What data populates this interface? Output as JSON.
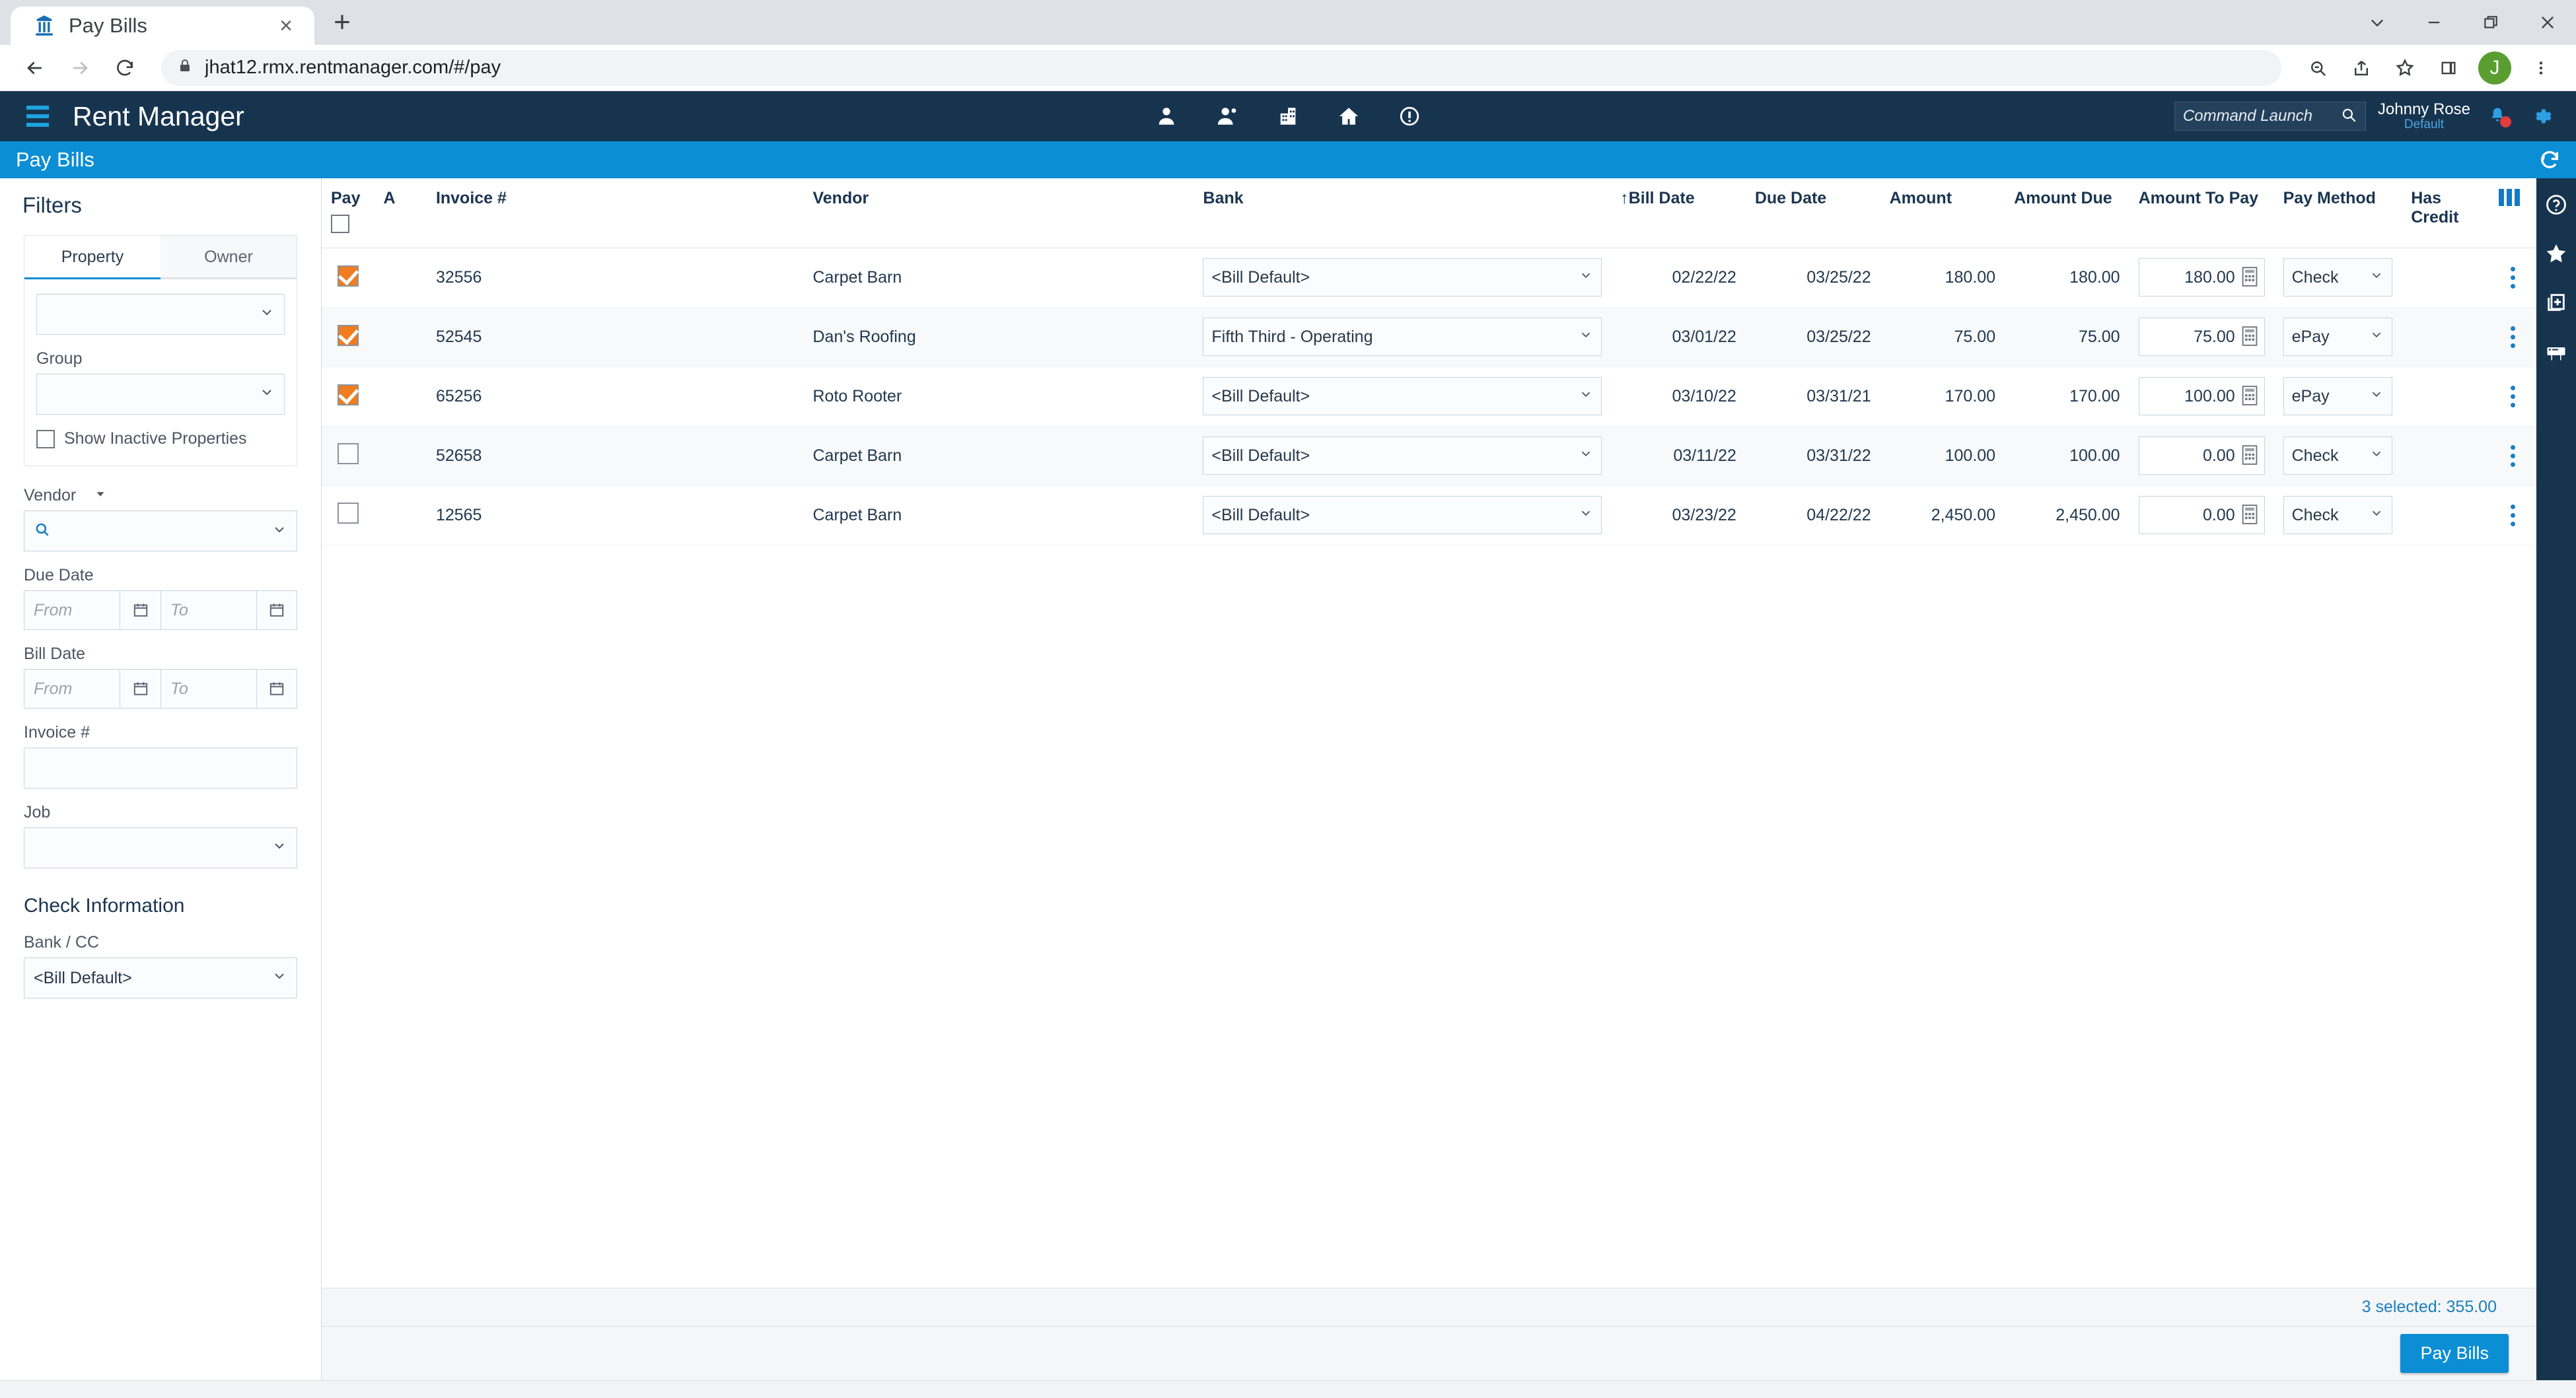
{
  "browser": {
    "tab_title": "Pay Bills",
    "favicon": "building-icon",
    "close_label": "×",
    "new_tab_label": "+",
    "url": "jhat12.rmx.rentmanager.com/#/pay",
    "profile_initial": "J",
    "window_controls": [
      "chevron-down",
      "minimize",
      "restore",
      "close"
    ],
    "omnibox_icons": [
      "zoom-out-icon",
      "share-icon",
      "star-icon",
      "side-panel-icon"
    ],
    "nav": {
      "back": "back-icon",
      "forward": "forward-icon",
      "reload": "reload-icon",
      "lock": "lock-icon"
    }
  },
  "app_header": {
    "brand": "Rent Manager",
    "center_icons": [
      "tenant-icon",
      "prospect-icon",
      "property-icon",
      "home-icon",
      "alert-icon"
    ],
    "command_launch_placeholder": "Command Launch",
    "user_name": "Johnny Rose",
    "user_role": "Default",
    "notification_icon": "bell-icon",
    "settings_icon": "gear-icon"
  },
  "breadcrumb": {
    "title": "Pay Bills",
    "refresh_icon": "refresh-icon"
  },
  "sidebar": {
    "title": "Filters",
    "tabs": [
      {
        "label": "Property",
        "active": true
      },
      {
        "label": "Owner",
        "active": false
      }
    ],
    "property_select_value": "",
    "group_label": "Group",
    "group_select_value": "",
    "show_inactive_label": "Show Inactive Properties",
    "show_inactive_checked": false,
    "vendor_label": "Vendor",
    "vendor_value": "",
    "due_date_label": "Due Date",
    "bill_date_label": "Bill Date",
    "from_placeholder": "From",
    "to_placeholder": "To",
    "invoice_label": "Invoice #",
    "invoice_value": "",
    "job_label": "Job",
    "job_value": "",
    "check_info_title": "Check Information",
    "bank_cc_label": "Bank / CC",
    "bank_cc_value": "<Bill Default>"
  },
  "grid": {
    "columns": [
      {
        "key": "pay",
        "label": "Pay"
      },
      {
        "key": "a",
        "label": "A"
      },
      {
        "key": "invoice",
        "label": "Invoice #"
      },
      {
        "key": "vendor",
        "label": "Vendor"
      },
      {
        "key": "bank",
        "label": "Bank"
      },
      {
        "key": "bill_date",
        "label": "Bill Date",
        "sort": "↑"
      },
      {
        "key": "due_date",
        "label": "Due Date"
      },
      {
        "key": "amount",
        "label": "Amount"
      },
      {
        "key": "amount_due",
        "label": "Amount Due"
      },
      {
        "key": "amount_to_pay",
        "label": "Amount To Pay"
      },
      {
        "key": "pay_method",
        "label": "Pay Method"
      },
      {
        "key": "has_credit",
        "label": "Has Credit"
      }
    ],
    "column_settings_icon": "column-grip-icon",
    "header_select_all_checked": false,
    "rows": [
      {
        "checked": true,
        "a": "",
        "invoice": "32556",
        "vendor": "Carpet Barn",
        "bank": "<Bill Default>",
        "bill_date": "02/22/22",
        "due_date": "03/25/22",
        "amount": "180.00",
        "amount_due": "180.00",
        "amount_to_pay": "180.00",
        "pay_method": "Check",
        "has_credit": ""
      },
      {
        "checked": true,
        "a": "",
        "invoice": "52545",
        "vendor": "Dan's Roofing",
        "bank": "Fifth Third - Operating",
        "bill_date": "03/01/22",
        "due_date": "03/25/22",
        "amount": "75.00",
        "amount_due": "75.00",
        "amount_to_pay": "75.00",
        "pay_method": "ePay",
        "has_credit": ""
      },
      {
        "checked": true,
        "a": "",
        "invoice": "65256",
        "vendor": "Roto Rooter",
        "bank": "<Bill Default>",
        "bill_date": "03/10/22",
        "due_date": "03/31/21",
        "amount": "170.00",
        "amount_due": "170.00",
        "amount_to_pay": "100.00",
        "pay_method": "ePay",
        "has_credit": ""
      },
      {
        "checked": false,
        "a": "",
        "invoice": "52658",
        "vendor": "Carpet Barn",
        "bank": "<Bill Default>",
        "bill_date": "03/11/22",
        "due_date": "03/31/22",
        "amount": "100.00",
        "amount_due": "100.00",
        "amount_to_pay": "0.00",
        "pay_method": "Check",
        "has_credit": ""
      },
      {
        "checked": false,
        "a": "",
        "invoice": "12565",
        "vendor": "Carpet Barn",
        "bank": "<Bill Default>",
        "bill_date": "03/23/22",
        "due_date": "04/22/22",
        "amount": "2,450.00",
        "amount_due": "2,450.00",
        "amount_to_pay": "0.00",
        "pay_method": "Check",
        "has_credit": ""
      }
    ]
  },
  "footer": {
    "status_text": "3 selected:  355.00",
    "pay_bills_button": "Pay Bills"
  },
  "right_rail": {
    "icons": [
      "help-icon",
      "favorite-star-icon",
      "add-page-icon",
      "print-icon"
    ]
  },
  "colors": {
    "header_navy": "#17344f",
    "accent_blue": "#0b8ed4",
    "checkbox_orange": "#f07d20",
    "link_blue": "#1a7fc1"
  }
}
